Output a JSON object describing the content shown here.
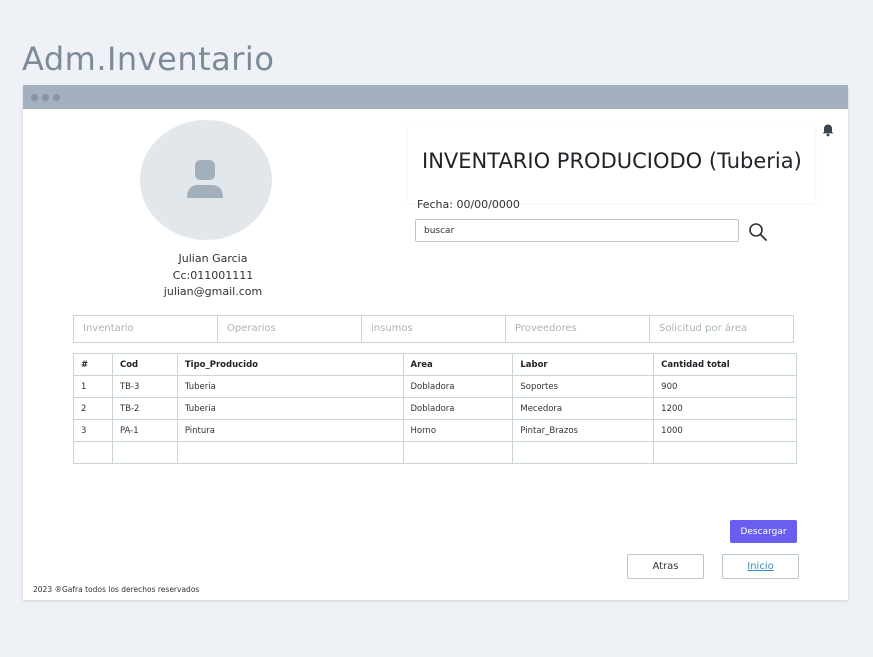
{
  "app_title": "Adm.Inventario",
  "user": {
    "name": "Julian Garcia",
    "cc": "Cc:011001111",
    "email": "julian@gmail.com"
  },
  "header": {
    "title": "INVENTARIO PRODUCIODO (Tuberia)",
    "fecha": "Fecha: 00/00/0000"
  },
  "search": {
    "value": "buscar"
  },
  "tabs": [
    "Inventario",
    "Operarios",
    "insumos",
    "Proveedores",
    "Solicitud por área"
  ],
  "table": {
    "headers": [
      "#",
      "Cod",
      "Tipo_Producido",
      "Area",
      "Labor",
      "Cantidad total"
    ],
    "rows": [
      [
        "1",
        "TB-3",
        "Tuberia",
        "Dobladora",
        "Soportes",
        "900"
      ],
      [
        "2",
        "TB-2",
        "Tuberia",
        "Dobladora",
        "Mecedora",
        "1200"
      ],
      [
        "3",
        "PA-1",
        "Pintura",
        "Horno",
        "Pintar_Brazos",
        "1000"
      ],
      [
        "",
        "",
        "",
        "",
        "",
        ""
      ]
    ]
  },
  "buttons": {
    "descargar": "Descargar",
    "atras": "Atras",
    "inicio": "Inicio"
  },
  "footer": "2023 ®Gafra todos los derechos reservados",
  "icons": {
    "bell": "bell-icon",
    "search": "search-icon",
    "avatar": "user-icon"
  },
  "colors": {
    "accent": "#6a5ef0",
    "titlebar": "#a2b1bd",
    "link": "#3b8bbd"
  }
}
